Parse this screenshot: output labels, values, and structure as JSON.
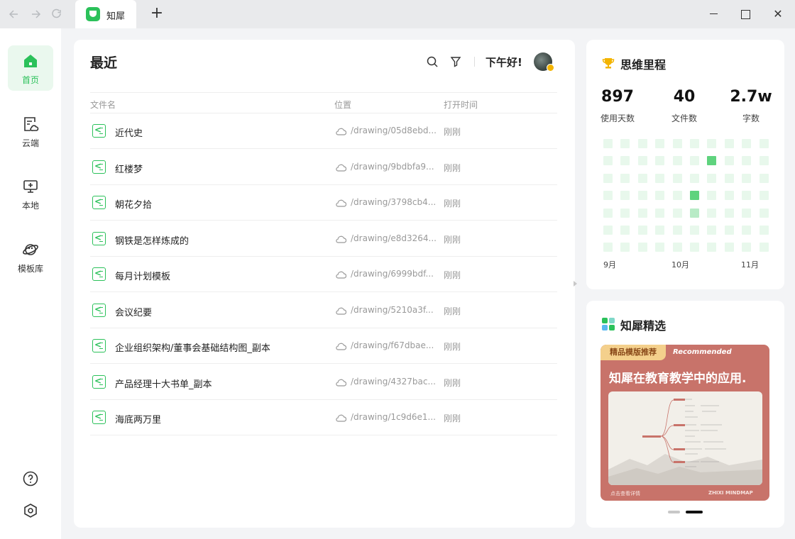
{
  "window": {
    "tab_title": "知犀",
    "add_tab": "+",
    "close_glyph": "✕"
  },
  "sidebar": {
    "items": [
      {
        "label": "首页",
        "icon": "home-icon"
      },
      {
        "label": "云端",
        "icon": "cloud-doc-icon"
      },
      {
        "label": "本地",
        "icon": "monitor-icon"
      },
      {
        "label": "模板库",
        "icon": "planet-icon"
      }
    ],
    "bottom": [
      {
        "icon": "help-icon"
      },
      {
        "icon": "settings-icon"
      }
    ]
  },
  "main": {
    "title": "最近",
    "greeting": "下午好!",
    "columns": {
      "name": "文件名",
      "location": "位置",
      "time": "打开时间"
    },
    "rows": [
      {
        "name": "近代史",
        "path": "/drawing/05d8ebd...",
        "time": "刚刚"
      },
      {
        "name": "红楼梦",
        "path": "/drawing/9bdbfa9...",
        "time": "刚刚"
      },
      {
        "name": "朝花夕拾",
        "path": "/drawing/3798cb4...",
        "time": "刚刚"
      },
      {
        "name": "钢铁是怎样炼成的",
        "path": "/drawing/e8d3264...",
        "time": "刚刚"
      },
      {
        "name": "每月计划模板",
        "path": "/drawing/6999bdf...",
        "time": "刚刚"
      },
      {
        "name": "会议纪要",
        "path": "/drawing/5210a3f...",
        "time": "刚刚"
      },
      {
        "name": "企业组织架构/董事会基础结构图_副本",
        "path": "/drawing/f67dbae...",
        "time": "刚刚"
      },
      {
        "name": "产品经理十大书单_副本",
        "path": "/drawing/4327bac...",
        "time": "刚刚"
      },
      {
        "name": "海底两万里",
        "path": "/drawing/1c9d6e1...",
        "time": "刚刚"
      }
    ]
  },
  "stats": {
    "title": "思维里程",
    "items": [
      {
        "value": "897",
        "label": "使用天数"
      },
      {
        "value": "40",
        "label": "文件数"
      },
      {
        "value": "2.7w",
        "label": "字数"
      }
    ],
    "months": [
      "9月",
      "10月",
      "11月"
    ],
    "heatmap": {
      "rows": 7,
      "cols": 10,
      "active": [
        {
          "row": 1,
          "col": 6,
          "level": 2
        },
        {
          "row": 3,
          "col": 5,
          "level": 2
        },
        {
          "row": 4,
          "col": 5,
          "level": 1
        }
      ],
      "colors": {
        "empty": "#e8f8ec",
        "low": "#b8ebc6",
        "high": "#5fd37e"
      }
    }
  },
  "featured": {
    "title": "知犀精选",
    "tag": "精品模版推荐",
    "tag_en": "Recommended",
    "headline": "知犀在教育教学中的应用.",
    "footer_left": "点击查看详情",
    "footer_right": "ZHIXI MINDMAP",
    "carousel": {
      "count": 2,
      "active": 1
    }
  },
  "colors": {
    "brand": "#2bc15a",
    "banner": "#c8736a"
  }
}
